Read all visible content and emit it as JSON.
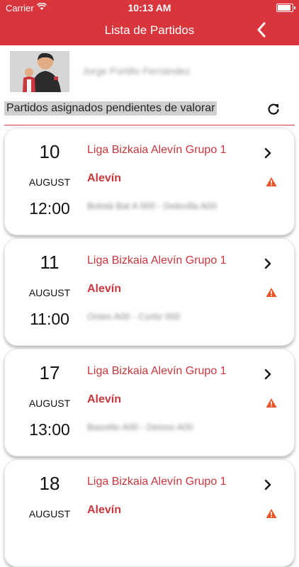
{
  "status_bar": {
    "carrier": "Carrier",
    "time": "10:13 AM"
  },
  "nav": {
    "title": "Lista de Partidos",
    "back_icon": "chevron-left-icon"
  },
  "profile": {
    "name": "Jorge Portillo Fernández"
  },
  "section": {
    "title": "Partidos asignados pendientes de valorar",
    "refresh_icon": "refresh-icon"
  },
  "matches": [
    {
      "day": "10",
      "month": "AUGUST",
      "time": "12:00",
      "league": "Liga Bizkaia Alevín Grupo 1",
      "category": "Alevín",
      "teams": "Bolotá Bat A 000 - Delevilla A00"
    },
    {
      "day": "11",
      "month": "AUGUST",
      "time": "11:00",
      "league": "Liga Bizkaia Alevín Grupo 1",
      "category": "Alevín",
      "teams": "Ontes A00 - Cortiz 000"
    },
    {
      "day": "17",
      "month": "AUGUST",
      "time": "13:00",
      "league": "Liga Bizkaia Alevín Grupo 1",
      "category": "Alevín",
      "teams": "Basotilo A00 - Deisso A00"
    },
    {
      "day": "18",
      "month": "AUGUST",
      "time": "",
      "league": "Liga Bizkaia Alevín Grupo 1",
      "category": "Alevín",
      "teams": ""
    }
  ],
  "colors": {
    "brand": "#d8353c",
    "accent_text": "#c8373d",
    "warning": "#e8542a"
  }
}
